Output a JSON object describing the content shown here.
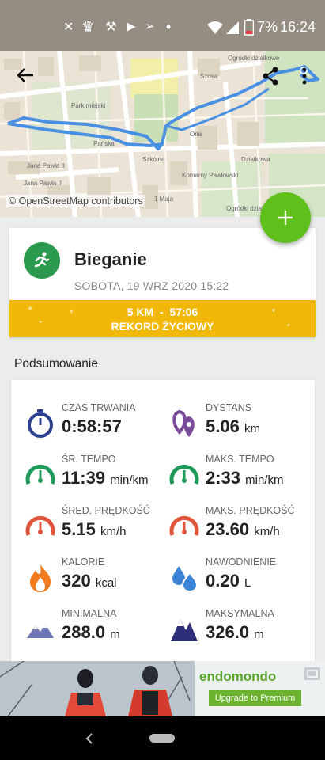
{
  "status_bar": {
    "battery": "7%",
    "time": "16:24"
  },
  "map": {
    "attribution": "© OpenStreetMap contributors",
    "labels": [
      "Ogródki działkowe",
      "Park miejski",
      "Pańska",
      "Szosa",
      "Ogródki działkowe",
      "Jana Pawła II",
      "Jana Pawła II",
      "1 Maja",
      "Komarny Pawłowski",
      "Orla",
      "Szkolna",
      "Działkowa"
    ]
  },
  "workout": {
    "sport": "Bieganie",
    "date": "SOBOTA, 19 WRZ 2020 15:22",
    "record_line1": "5 KM  -  57:06",
    "record_line2": "REKORD ŻYCIOWY"
  },
  "summary_title": "Podsumowanie",
  "stats": [
    {
      "label": "CZAS TRWANIA",
      "value": "0:58:57",
      "unit": "",
      "icon": "stopwatch-icon"
    },
    {
      "label": "DYSTANS",
      "value": "5.06",
      "unit": "km",
      "icon": "distance-pins-icon"
    },
    {
      "label": "ŚR. TEMPO",
      "value": "11:39",
      "unit": "min/km",
      "icon": "pace-gauge-icon"
    },
    {
      "label": "MAKS. TEMPO",
      "value": "2:33",
      "unit": "min/km",
      "icon": "pace-gauge-icon"
    },
    {
      "label": "ŚRED. PRĘDKOŚĆ",
      "value": "5.15",
      "unit": "km/h",
      "icon": "speed-gauge-icon"
    },
    {
      "label": "MAKS. PRĘDKOŚĆ",
      "value": "23.60",
      "unit": "km/h",
      "icon": "speed-gauge-icon"
    },
    {
      "label": "KALORIE",
      "value": "320",
      "unit": "kcal",
      "icon": "flame-icon"
    },
    {
      "label": "NAWODNIENIE",
      "value": "0.20",
      "unit": "L",
      "icon": "water-drops-icon"
    },
    {
      "label": "MINIMALNA",
      "value": "288.0",
      "unit": "m",
      "icon": "mountain-icon"
    },
    {
      "label": "MAKSYMALNA",
      "value": "326.0",
      "unit": "m",
      "icon": "mountain-icon"
    }
  ],
  "ad": {
    "brand": "endomondo",
    "button": "Upgrade to Premium"
  },
  "colors": {
    "accent_green": "#5fbf1b",
    "sport_green": "#2c9a4e",
    "record_yellow": "#f2b808",
    "route_blue": "#4a90e2",
    "timer_blue": "#2d3f8f",
    "pace_green": "#1f9a5a",
    "speed_red": "#e2553d",
    "purple": "#7a4a9a"
  }
}
